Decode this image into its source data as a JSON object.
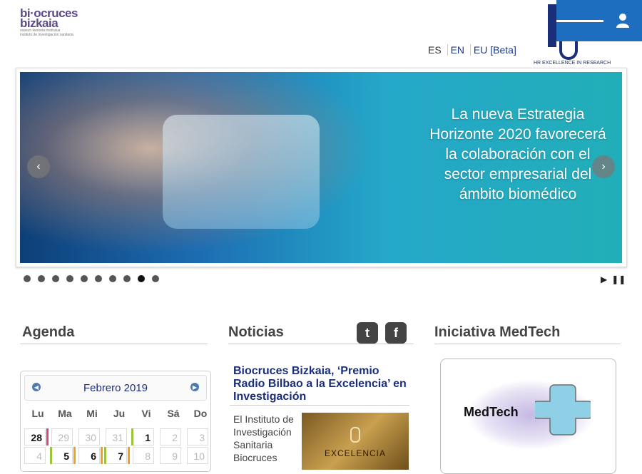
{
  "header": {
    "logo_line1": "bi·ocruces",
    "logo_line2": "bizkaia",
    "logo_sub1": "osasun ikerketa institutua",
    "logo_sub2": "instituto de investigación sanitaria",
    "hr_badge_text": "HR EXCELLENCE IN RESEARCH"
  },
  "languages": [
    "ES",
    "EN",
    "EU [Beta]"
  ],
  "slider": {
    "caption": "La nueva Estrategia Horizonte 2020 favorecerá la colaboración con el sector empresarial del ámbito biomédico",
    "dot_count": 10,
    "active_dot": 9,
    "prev": "‹",
    "next": "›",
    "play": "▶",
    "pause": "❚❚"
  },
  "agenda": {
    "title": "Agenda",
    "month": "Febrero 2019",
    "weekdays": [
      "Lu",
      "Ma",
      "Mi",
      "Ju",
      "Vi",
      "Sá",
      "Do"
    ],
    "row1": [
      "28",
      "29",
      "30",
      "31",
      "1",
      "2",
      "3"
    ],
    "row2": [
      "4",
      "5",
      "6",
      "7",
      "8",
      "9",
      "10"
    ]
  },
  "noticias": {
    "title": "Noticias",
    "headline": "Biocruces Bizkaia, ‘Premio Radio Bilbao a la Excelencia’ en Investigación",
    "body": "El Instituto de Investigación Sanitaria Biocruces",
    "image_text": "EXCELENCIA",
    "twitter": "t",
    "facebook": "f"
  },
  "medtech": {
    "title": "Iniciativa MedTech",
    "card_label": "MedTech"
  },
  "colors": {
    "brand_blue": "#1e6ec0",
    "nav_text": "#1a2e7a"
  }
}
